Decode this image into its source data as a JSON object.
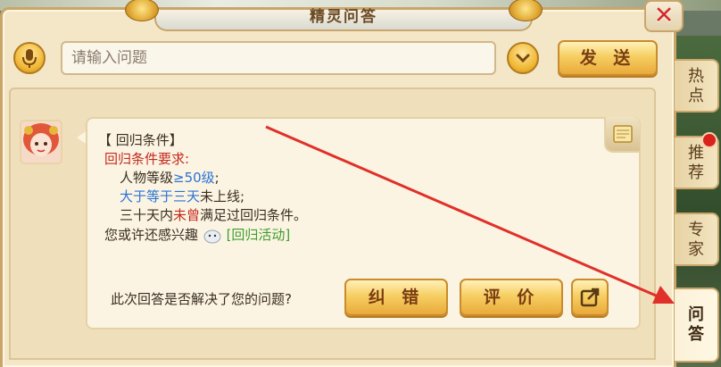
{
  "window": {
    "title": "精灵问答",
    "close_icon": "close-icon"
  },
  "input_row": {
    "mic_icon": "microphone-icon",
    "placeholder": "请输入问题",
    "dropdown_icon": "chevron-down-icon",
    "send_label": "发 送"
  },
  "answer": {
    "header": "【 回归条件】",
    "requirement_title": "回归条件要求:",
    "level_prefix": "人物等级",
    "level_value": "≥50级",
    "level_suffix": ";",
    "offline_highlight": "大于等于三天",
    "offline_suffix": "未上线;",
    "thirty_prefix": "三十天内",
    "thirty_highlight": "未曾",
    "thirty_suffix": "满足过回归条件。",
    "interest_prefix": "您或许还感兴趣",
    "interest_link": "[回归活动]"
  },
  "feedback": {
    "question": "此次回答是否解决了您的问题?",
    "correct_label": "纠 错",
    "rate_label": "评 价",
    "share_icon": "external-link-icon"
  },
  "side_tabs": [
    {
      "label": "热\n点"
    },
    {
      "label": "推\n荐"
    },
    {
      "label": "专\n家"
    },
    {
      "label": "问\n答"
    }
  ],
  "colors": {
    "accent_gold": "#f6cf63",
    "highlight_red": "#c42a1f",
    "highlight_blue": "#2a73d6",
    "link_green": "#3f9d2e",
    "annotation_arrow": "#e0302a"
  }
}
